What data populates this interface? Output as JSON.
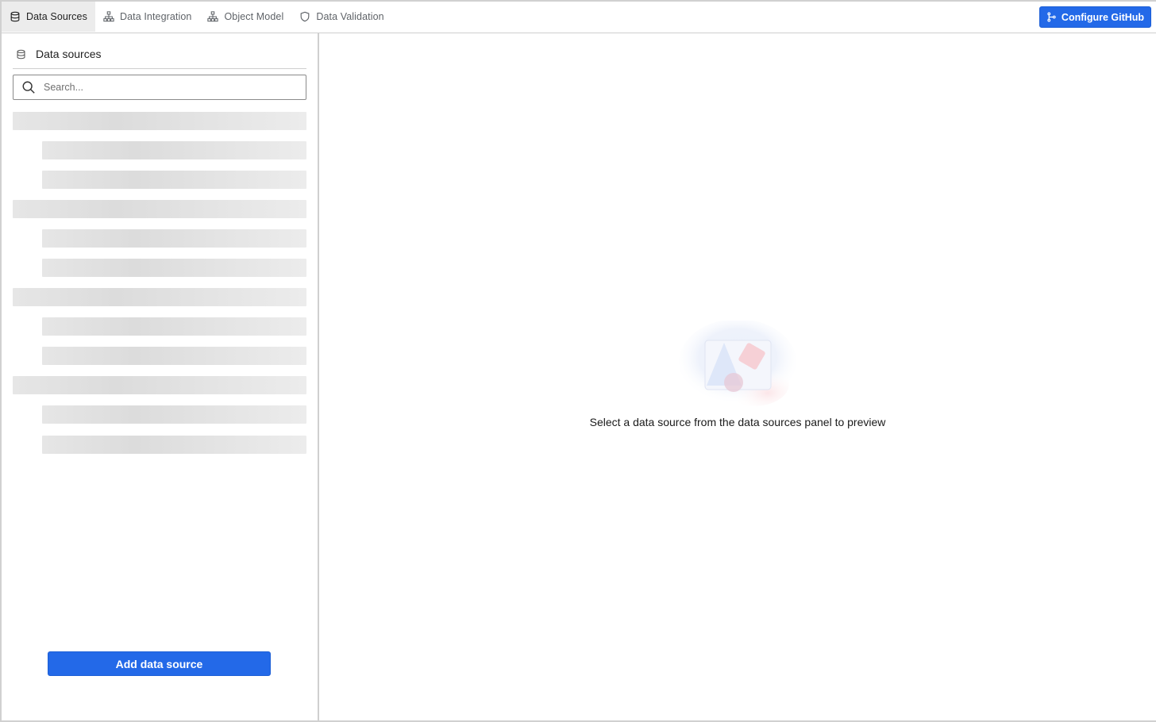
{
  "topbar": {
    "tabs": [
      {
        "label": "Data Sources",
        "icon": "database-icon",
        "active": true
      },
      {
        "label": "Data Integration",
        "icon": "hierarchy-icon",
        "active": false
      },
      {
        "label": "Object Model",
        "icon": "hierarchy-icon",
        "active": false
      },
      {
        "label": "Data Validation",
        "icon": "shield-icon",
        "active": false
      }
    ],
    "configure_github_label": "Configure GitHub"
  },
  "sidebar": {
    "title": "Data sources",
    "search_placeholder": "Search...",
    "add_button_label": "Add data source"
  },
  "main": {
    "empty_message": "Select a data source from the data sources panel to preview"
  },
  "colors": {
    "primary": "#2369e8",
    "active_tab_bg": "#ececec",
    "skeleton": "#e2e2e2"
  }
}
